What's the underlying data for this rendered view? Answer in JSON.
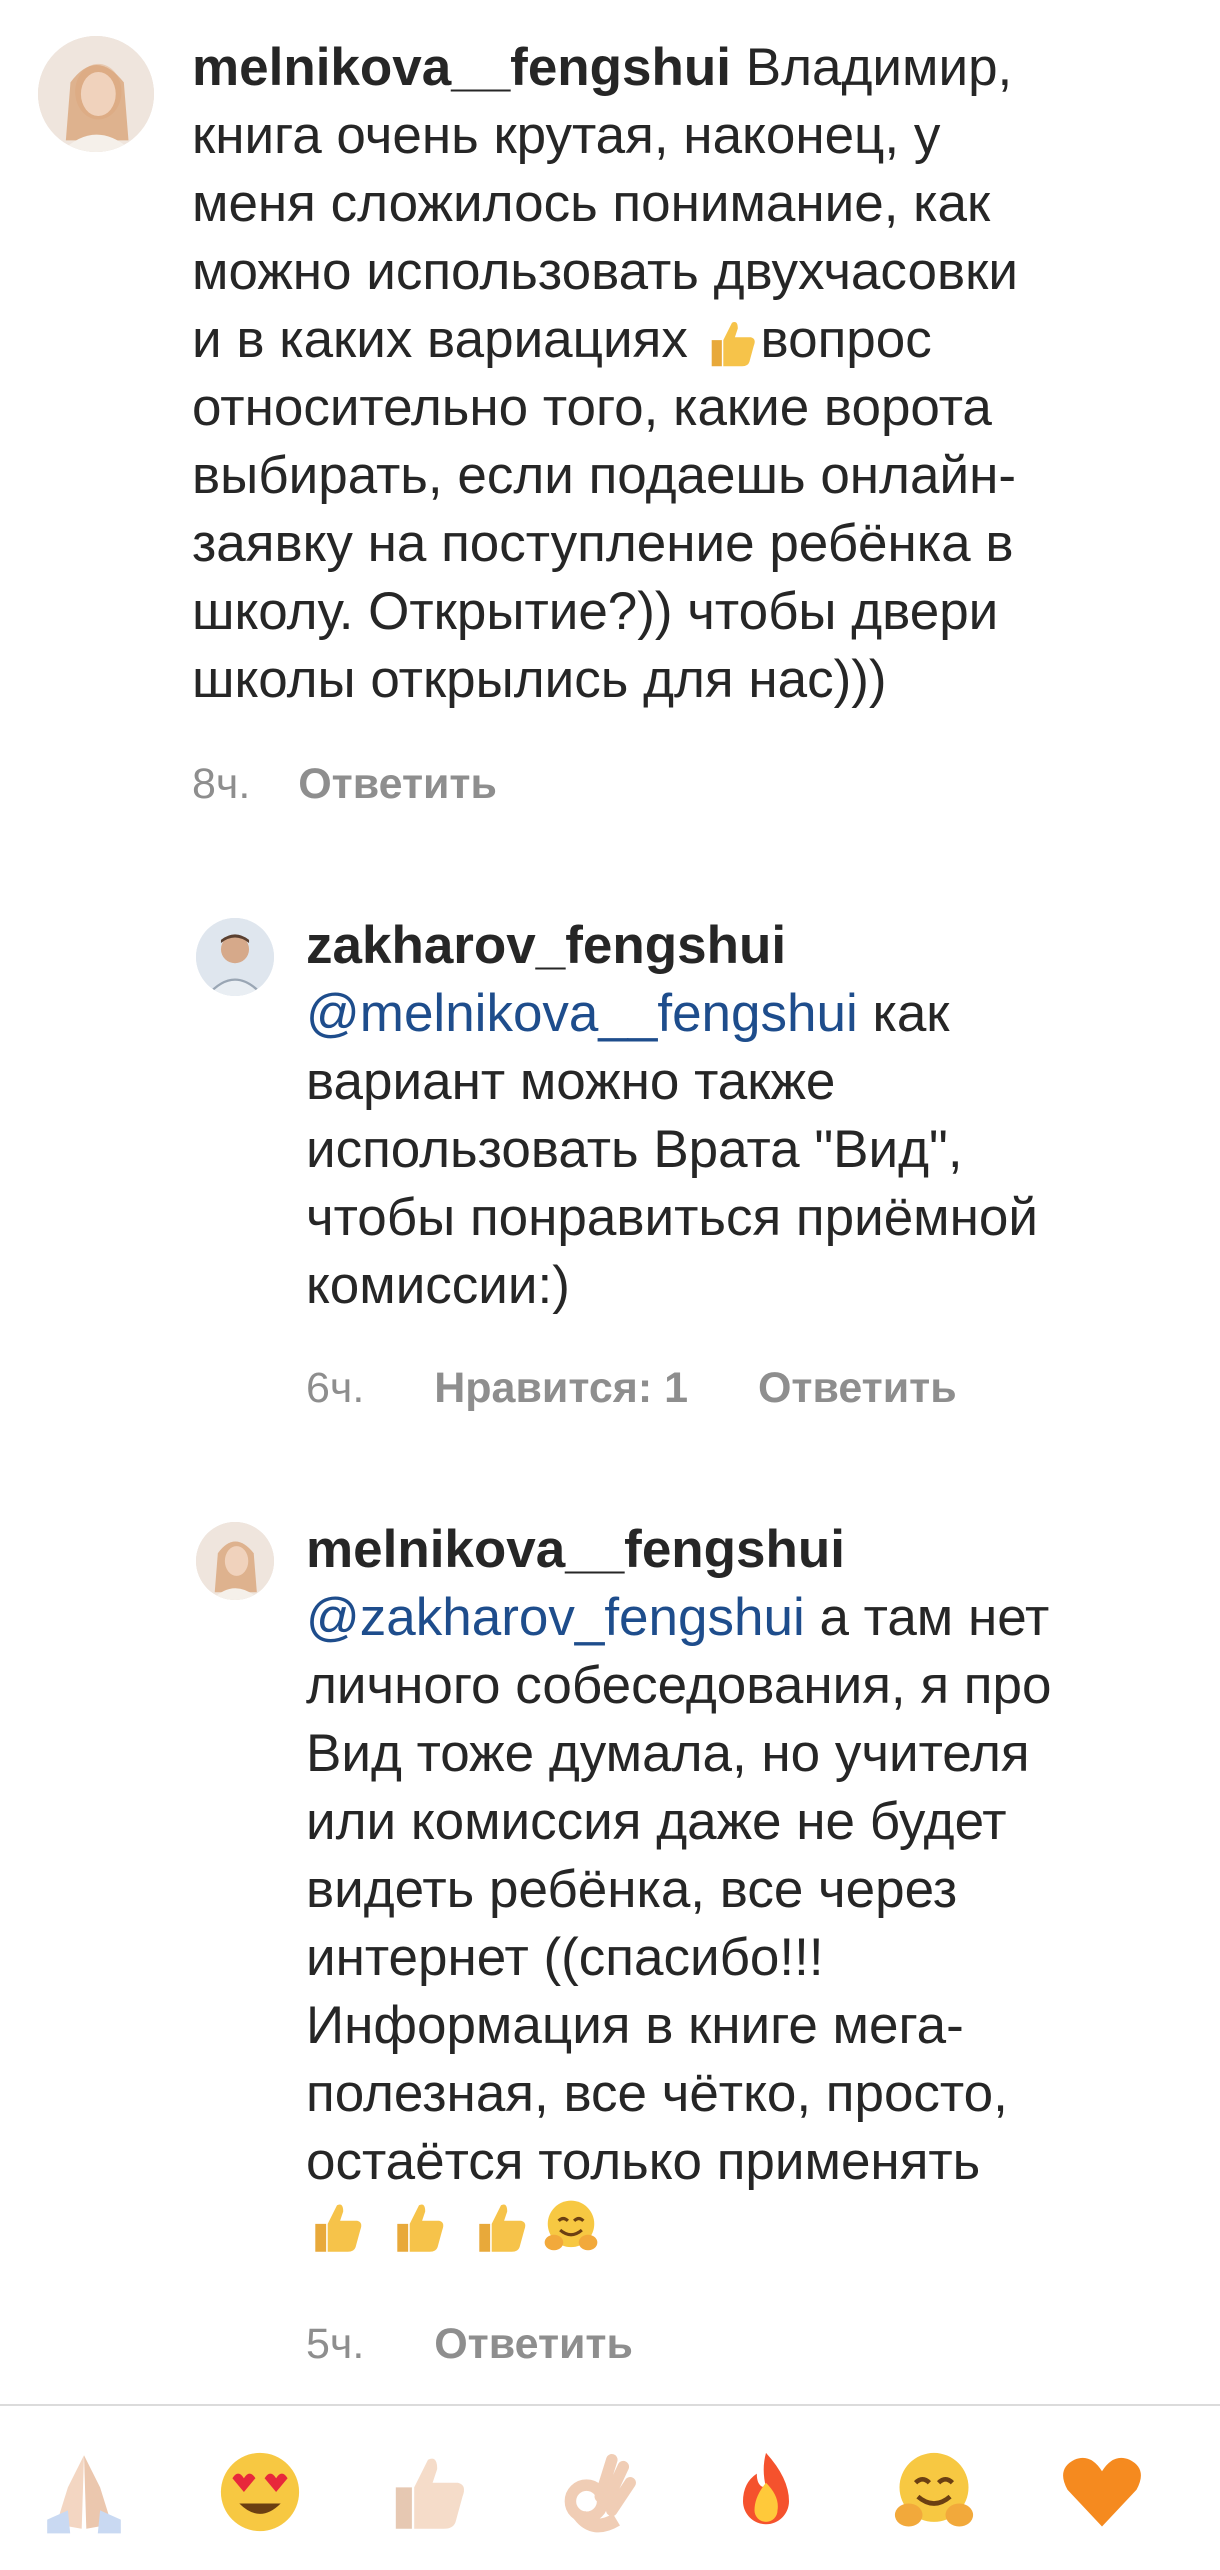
{
  "comments": [
    {
      "username": "melnikova__fengshui",
      "lines": [
        "Владимир,",
        "книга очень крутая, наконец, у",
        "меня сложилось понимание, как",
        "можно  использовать двухчасовки",
        "и в каких вариациях ",
        "вопрос",
        "относительно того, какие ворота",
        "выбирать, если подаешь онлайн-",
        "заявку на поступление ребёнка в",
        "школу. Открытие?)) чтобы двери",
        "школы открылись для нас)))"
      ],
      "time": "8ч.",
      "reply_label": "Ответить"
    },
    {
      "username": "zakharov_fengshui",
      "mention": "@melnikova__fengshui",
      "lines": [
        " как",
        "вариант можно также",
        "использовать Врата \"Вид\",",
        "чтобы понравиться приёмной",
        "комиссии:)"
      ],
      "time": "6ч.",
      "likes_label": "Нравится: 1",
      "reply_label": "Ответить"
    },
    {
      "username": "melnikova__fengshui",
      "mention": "@zakharov_fengshui",
      "lines": [
        " а там нет",
        "личного собеседования, я про",
        "Вид тоже думала, но учителя",
        "или комиссия даже не будет",
        "видеть ребёнка, все через",
        "интернет ((спасибо!!!",
        "Информация в книге мега-",
        "полезная, все чётко, просто,",
        "остаётся только применять"
      ],
      "emoji_line": [
        "thumbs-up",
        "thumbs-up",
        "thumbs-up",
        "hugging-face"
      ],
      "time": "5ч.",
      "reply_label": "Ответить"
    }
  ],
  "reaction_bar": [
    "folded-hands",
    "heart-eyes",
    "thumbs-up",
    "ok-hand",
    "fire",
    "hugging-face",
    "orange-heart"
  ],
  "colors": {
    "text": "#262626",
    "meta": "#8e8e8e",
    "mention": "#1e4d8c",
    "divider": "#dbdbdb"
  }
}
